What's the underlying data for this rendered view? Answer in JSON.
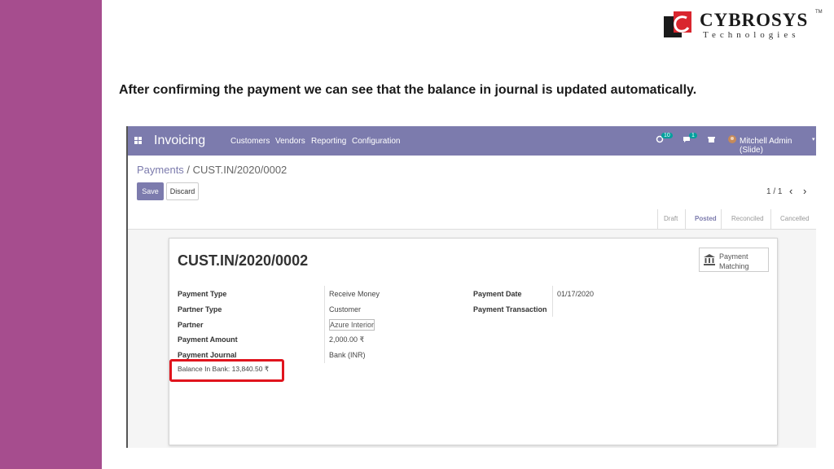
{
  "slide": {
    "headline": "After confirming the payment we can see that the balance in journal is updated  automatically.",
    "logo": {
      "name": "CYBROSYS",
      "tm": "TM",
      "sub": "Technologies"
    },
    "colors": {
      "left_bar": "#a64d8e",
      "navbar": "#7c7bad",
      "highlight": "#e0141d"
    }
  },
  "navbar": {
    "app": "Invoicing",
    "menu": [
      "Customers",
      "Vendors",
      "Reporting",
      "Configuration"
    ],
    "activity_count": "10",
    "message_count": "1",
    "user": "Mitchell Admin (Slide)"
  },
  "control": {
    "breadcrumb_parent": "Payments",
    "breadcrumb_sep": " / ",
    "breadcrumb_current": "CUST.IN/2020/0002",
    "save": "Save",
    "discard": "Discard",
    "pager": "1 / 1",
    "prev": "‹",
    "next": "›"
  },
  "status": {
    "stages": [
      "Draft",
      "Posted",
      "Reconciled",
      "Cancelled"
    ],
    "active": "Posted"
  },
  "form": {
    "title": "CUST.IN/2020/0002",
    "smart_button": {
      "line1": "Payment",
      "line2": "Matching",
      "icon": "bank-icon"
    },
    "left_labels": [
      "Payment Type",
      "Partner Type",
      "Partner",
      "Payment Amount",
      "Payment Journal"
    ],
    "left_values": [
      "Receive Money",
      "Customer",
      "Azure Interior",
      "2,000.00 ₹",
      "Bank (INR)"
    ],
    "right_labels": [
      "Payment Date",
      "Payment Transaction"
    ],
    "right_values": [
      "01/17/2020",
      ""
    ],
    "balance": "Balance In Bank: 13,840.50 ₹"
  }
}
